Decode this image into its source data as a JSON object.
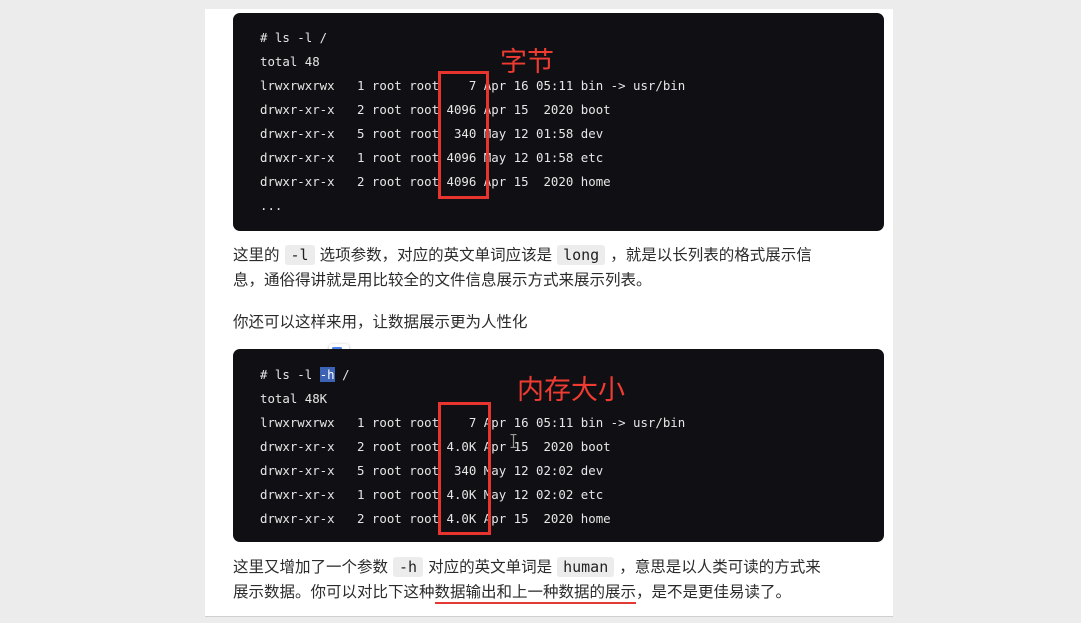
{
  "terminal1": {
    "lines": [
      "# ls -l /",
      "total 48",
      "lrwxrwxrwx   1 root root    7 Apr 16 05:11 bin -> usr/bin",
      "drwxr-xr-x   2 root root 4096 Apr 15  2020 boot",
      "drwxr-xr-x   5 root root  340 May 12 01:58 dev",
      "drwxr-xr-x   1 root root 4096 May 12 01:58 etc",
      "drwxr-xr-x   2 root root 4096 Apr 15  2020 home",
      "..."
    ],
    "annotation": "字节"
  },
  "paragraph1": {
    "line1_pre": "这里的",
    "code1": "-l",
    "line1_mid": "选项参数，对应的英文单词应该是",
    "code2": "long",
    "line1_post": "，就是以长列表的格式展示信",
    "line2": "息，通俗得讲就是用比较全的文件信息展示方式来展示列表。"
  },
  "paragraph2": "你还可以这样来用，让数据展示更为人性化",
  "terminal2": {
    "cmd_pre": "# ls -l ",
    "cmd_sel": "-h",
    "cmd_post": " /",
    "lines": [
      "total 48K",
      "lrwxrwxrwx   1 root root    7 Apr 16 05:11 bin -> usr/bin",
      "drwxr-xr-x   2 root root 4.0K Apr 15  2020 boot",
      "drwxr-xr-x   5 root root  340 May 12 02:02 dev",
      "drwxr-xr-x   1 root root 4.0K May 12 02:02 etc",
      "drwxr-xr-x   2 root root 4.0K Apr 15  2020 home"
    ],
    "annotation": "内存大小"
  },
  "paragraph3": {
    "line1_pre": "这里又增加了一个参数",
    "code1": "-h",
    "line1_mid": "对应的英文单词是",
    "code2": "human",
    "line1_post": "，意思是以人类可读的方式来",
    "line2_pre": "展示数据。你可以对比下这种",
    "line2_underlined": "数据输出和上一种数据的展示",
    "line2_post": "，是不是更佳易读了。"
  },
  "icons": {
    "translate": "translate-icon",
    "text_cursor": "text-cursor-icon"
  },
  "colors": {
    "annotation_red": "#e8342e",
    "terminal_bg": "#101014",
    "selection_blue": "#3d64b4"
  }
}
